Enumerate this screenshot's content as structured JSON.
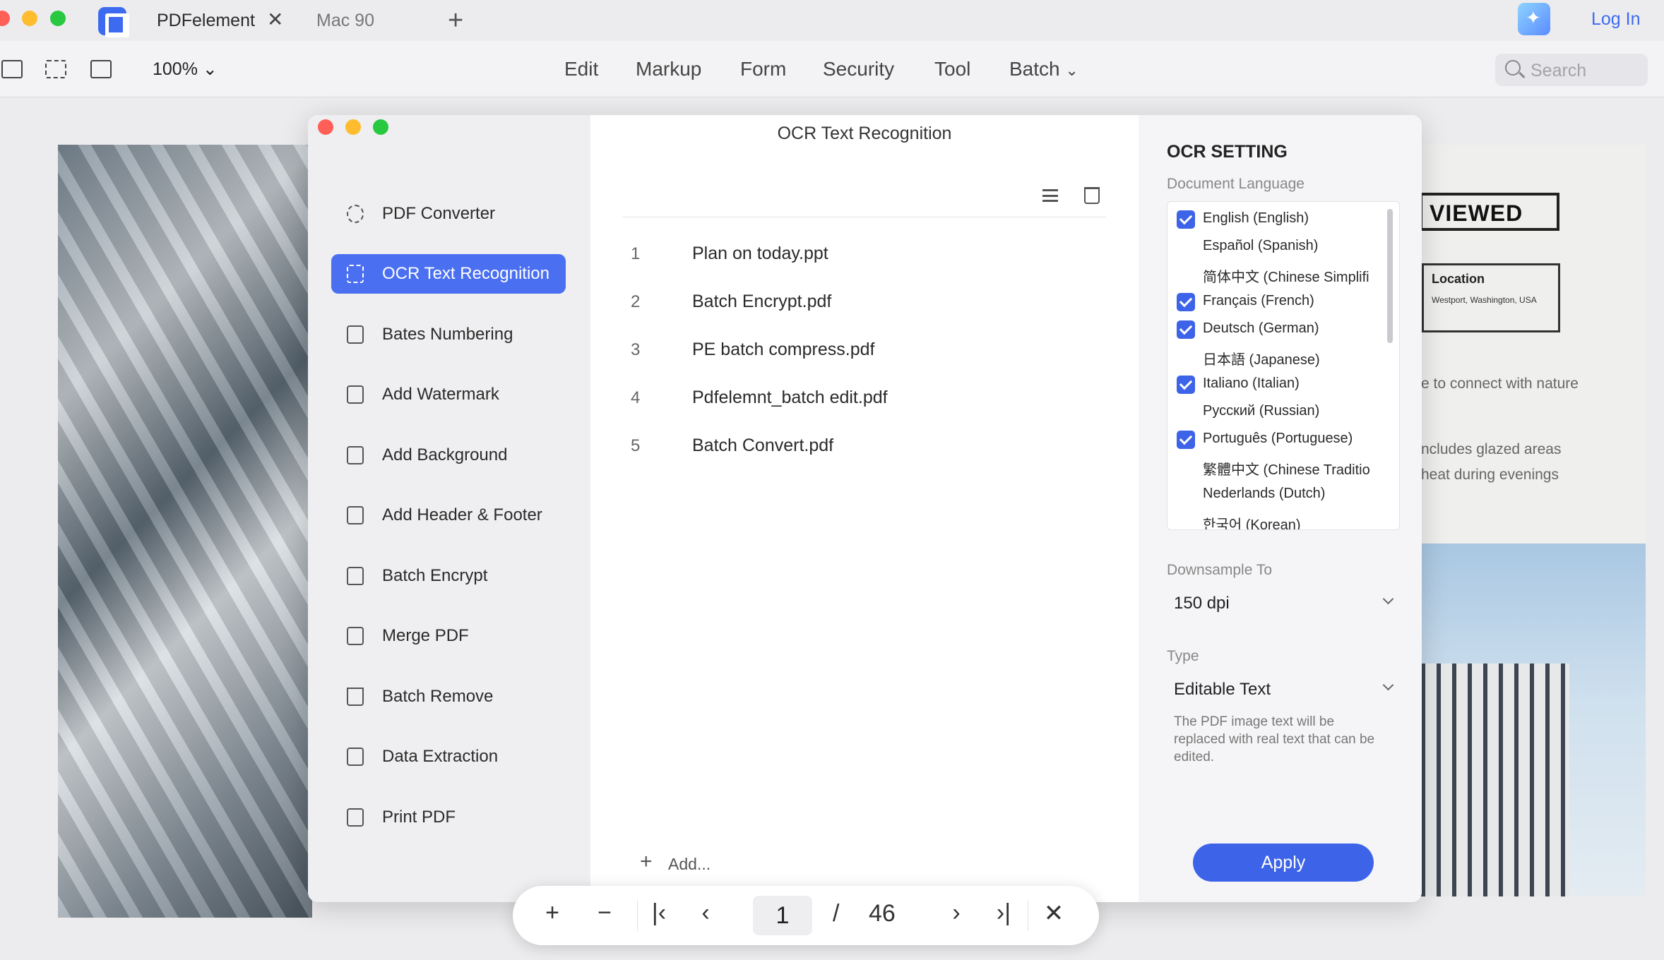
{
  "tabbar": {
    "tabs": [
      {
        "label": "PDFelement",
        "active": true
      },
      {
        "label": "Mac 90",
        "active": false
      }
    ],
    "new_tab_icon": "plus-icon",
    "close_icon": "close-icon",
    "login": "Log In"
  },
  "toolbar": {
    "zoom": "100%",
    "menu": [
      "Edit",
      "Markup",
      "Form",
      "Security",
      "Tool",
      "Batch"
    ],
    "search_placeholder": "Search"
  },
  "document": {
    "badge": "VIEWED",
    "location_title": "Location",
    "location_sub": "Westport, Washington, USA",
    "line1": "e to connect with nature",
    "line2": "ncludes glazed areas",
    "line3": "heat during evenings"
  },
  "window": {
    "title": "OCR Text Recognition",
    "sidebar": [
      {
        "label": "PDF Converter",
        "icon": "refresh-icon",
        "active": false
      },
      {
        "label": "OCR Text Recognition",
        "icon": "scan-text-icon",
        "active": true
      },
      {
        "label": "Bates Numbering",
        "icon": "numbering-icon",
        "active": false
      },
      {
        "label": "Add Watermark",
        "icon": "watermark-icon",
        "active": false
      },
      {
        "label": "Add Background",
        "icon": "background-icon",
        "active": false
      },
      {
        "label": "Add Header & Footer",
        "icon": "header-footer-icon",
        "active": false
      },
      {
        "label": "Batch Encrypt",
        "icon": "lock-icon",
        "active": false
      },
      {
        "label": "Merge PDF",
        "icon": "merge-icon",
        "active": false
      },
      {
        "label": "Batch Remove",
        "icon": "trash-icon",
        "active": false
      },
      {
        "label": "Data Extraction",
        "icon": "export-icon",
        "active": false
      },
      {
        "label": "Print PDF",
        "icon": "printer-icon",
        "active": false
      }
    ],
    "files": [
      {
        "num": "1",
        "name": "Plan on today.ppt"
      },
      {
        "num": "2",
        "name": "Batch Encrypt.pdf"
      },
      {
        "num": "3",
        "name": "PE batch compress.pdf"
      },
      {
        "num": "4",
        "name": "Pdfelemnt_batch edit.pdf"
      },
      {
        "num": "5",
        "name": "Batch Convert.pdf"
      }
    ],
    "add_label": "Add...",
    "settings": {
      "title": "OCR SETTING",
      "language_label": "Document Language",
      "languages": [
        {
          "label": "English (English)",
          "checked": true
        },
        {
          "label": "Español (Spanish)",
          "checked": false
        },
        {
          "label": "简体中文 (Chinese Simplifi",
          "checked": false
        },
        {
          "label": "Français (French)",
          "checked": true
        },
        {
          "label": "Deutsch (German)",
          "checked": true
        },
        {
          "label": "日本語 (Japanese)",
          "checked": false
        },
        {
          "label": "Italiano (Italian)",
          "checked": true
        },
        {
          "label": "Русский (Russian)",
          "checked": false
        },
        {
          "label": "Português (Portuguese)",
          "checked": true
        },
        {
          "label": "繁體中文 (Chinese Traditio",
          "checked": false
        },
        {
          "label": "Nederlands (Dutch)",
          "checked": false
        },
        {
          "label": "한국어 (Korean)",
          "checked": false
        }
      ],
      "downsample_label": "Downsample To",
      "downsample_value": "150 dpi",
      "type_label": "Type",
      "type_value": "Editable Text",
      "type_desc": "The PDF image text will be replaced with real text that can be edited.",
      "apply": "Apply"
    }
  },
  "pager": {
    "current": "1",
    "slash": "/",
    "total": "46"
  },
  "colors": {
    "accent": "#3d63e8",
    "traffic_red": "#ff5f57",
    "traffic_yellow": "#febc2e",
    "traffic_green": "#28c840"
  }
}
